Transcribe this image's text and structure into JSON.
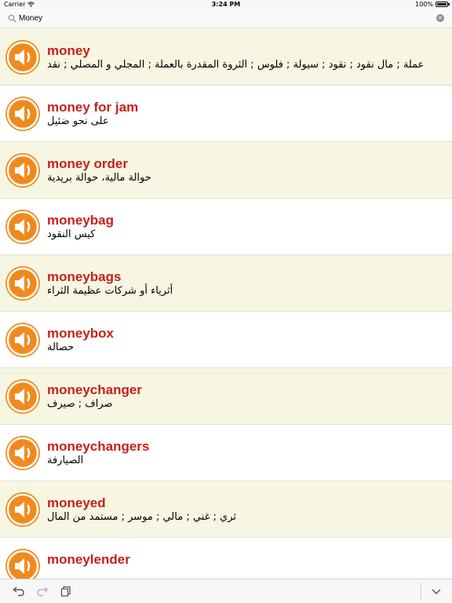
{
  "status_bar": {
    "carrier": "Carrier",
    "time": "3:24 PM",
    "battery": "100%"
  },
  "search": {
    "value": "Money",
    "icons": [
      "search-icon",
      "clear-icon"
    ]
  },
  "entries": [
    {
      "word": "money",
      "translation": "عملة ; مال نقود ; نقود ; سيولة ; فلوس ; الثروة المقدرة بالعملة ; المجلي و المصلي ; نقد"
    },
    {
      "word": "money for jam",
      "translation": "على نحو ضئيل"
    },
    {
      "word": "money order",
      "translation": "حوالة مالية، حوالة بريدية"
    },
    {
      "word": "moneybag",
      "translation": "كيس النقود"
    },
    {
      "word": "moneybags",
      "translation": "أثرياء أو شركات عظيمة الثراء"
    },
    {
      "word": "moneybox",
      "translation": "حصالة"
    },
    {
      "word": "moneychanger",
      "translation": "صراف ; صيرف"
    },
    {
      "word": "moneychangers",
      "translation": "الصيارفة"
    },
    {
      "word": "moneyed",
      "translation": "ثري ; غني ; مالي ; موسر ; مستمد من المال"
    },
    {
      "word": "moneylender",
      "translation": ""
    }
  ],
  "colors": {
    "accent": "#f08a1e",
    "word": "#c8201c",
    "alt_row": "#f6f6e2"
  },
  "toolbar": {
    "icons": [
      "undo-icon",
      "redo-icon",
      "copy-icon",
      "chevron-down-icon"
    ]
  }
}
